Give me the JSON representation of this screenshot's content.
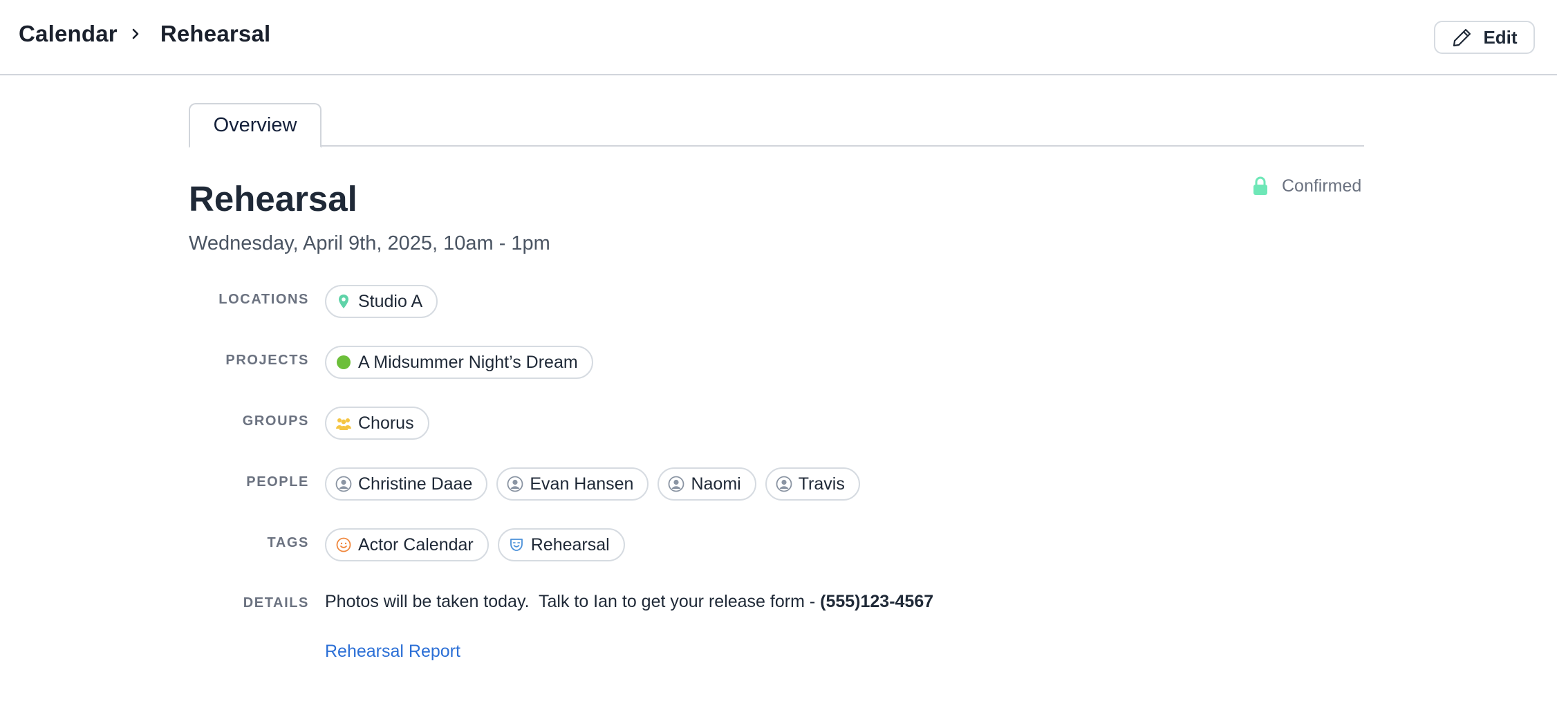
{
  "breadcrumb": {
    "root": "Calendar",
    "current": "Rehearsal"
  },
  "header": {
    "edit_label": "Edit"
  },
  "tabs": [
    {
      "label": "Overview",
      "active": true
    }
  ],
  "event": {
    "title": "Rehearsal",
    "datetime": "Wednesday, April 9th, 2025, 10am - 1pm",
    "status": {
      "label": "Confirmed",
      "icon": "lock-icon",
      "color": "#6ee7b7"
    }
  },
  "fields": {
    "locations": {
      "label": "LOCATIONS",
      "items": [
        {
          "name": "Studio A",
          "icon": "map-pin-icon",
          "color": "#5fd3a8"
        }
      ]
    },
    "projects": {
      "label": "PROJECTS",
      "items": [
        {
          "name": "A Midsummer Night’s Dream",
          "icon": "project-dot-icon",
          "color": "#6cbf3a"
        }
      ]
    },
    "groups": {
      "label": "GROUPS",
      "items": [
        {
          "name": "Chorus",
          "icon": "group-icon",
          "color": "#f5c542"
        }
      ]
    },
    "people": {
      "label": "PEOPLE",
      "items": [
        {
          "name": "Christine Daae",
          "icon": "user-avatar-icon"
        },
        {
          "name": "Evan Hansen",
          "icon": "user-avatar-icon"
        },
        {
          "name": "Naomi",
          "icon": "user-avatar-icon"
        },
        {
          "name": "Travis",
          "icon": "user-avatar-icon"
        }
      ]
    },
    "tags": {
      "label": "TAGS",
      "items": [
        {
          "name": "Actor Calendar",
          "icon": "smile-icon",
          "color": "#f0883e"
        },
        {
          "name": "Rehearsal",
          "icon": "theater-mask-icon",
          "color": "#4a90d9"
        }
      ]
    },
    "details": {
      "label": "DETAILS",
      "text": "Photos will be taken today.  Talk to Ian to get your release form - ",
      "phone": "(555)123-4567",
      "link_label": "Rehearsal Report"
    }
  },
  "colors": {
    "link": "#2b6fd6",
    "border": "#d6dbe1",
    "label": "#6b7280"
  }
}
